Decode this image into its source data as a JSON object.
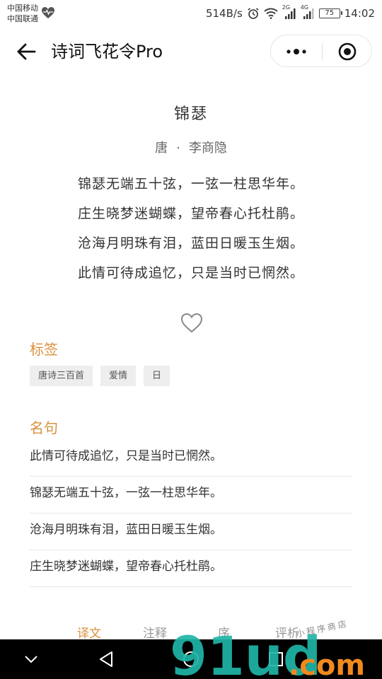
{
  "status_bar": {
    "carrier_1": "中国移动",
    "carrier_2": "中国联通",
    "speed": "514B/s",
    "net_2g": "2G",
    "net_4g": "4G",
    "battery": "75",
    "time": "14:02"
  },
  "header": {
    "title": "诗词飞花令Pro",
    "icons": {
      "back": "arrow-left-icon",
      "more": "more-dots-icon",
      "close": "target-circle-icon"
    }
  },
  "poem": {
    "title": "锦瑟",
    "dynasty": "唐",
    "separator": "·",
    "author": "李商隐",
    "lines": [
      "锦瑟无端五十弦，一弦一柱思华年。",
      "庄生晓梦迷蝴蝶，望帝春心托杜鹃。",
      "沧海月明珠有泪，蓝田日暖玉生烟。",
      "此情可待成追忆，只是当时已惘然。"
    ]
  },
  "favorite": {
    "icon": "heart-outline-icon"
  },
  "tags_section": {
    "title": "标签",
    "tags": [
      "唐诗三百首",
      "爱情",
      "日"
    ]
  },
  "quotes_section": {
    "title": "名句",
    "quotes": [
      "此情可待成追忆，只是当时已惘然。",
      "锦瑟无端五十弦，一弦一柱思华年。",
      "沧海月明珠有泪，蓝田日暖玉生烟。",
      "庄生晓梦迷蝴蝶，望帝春心托杜鹃。"
    ]
  },
  "tabs": {
    "items": [
      "译文",
      "注释",
      "序",
      "评析"
    ],
    "active": "译文"
  },
  "watermark": {
    "logo": "91ud",
    "suffix": ".com",
    "script": "小程序商店"
  },
  "colors": {
    "accent": "#d9913c",
    "watermark_teal": "#1fb5a8",
    "watermark_orange": "#f08a1e"
  }
}
